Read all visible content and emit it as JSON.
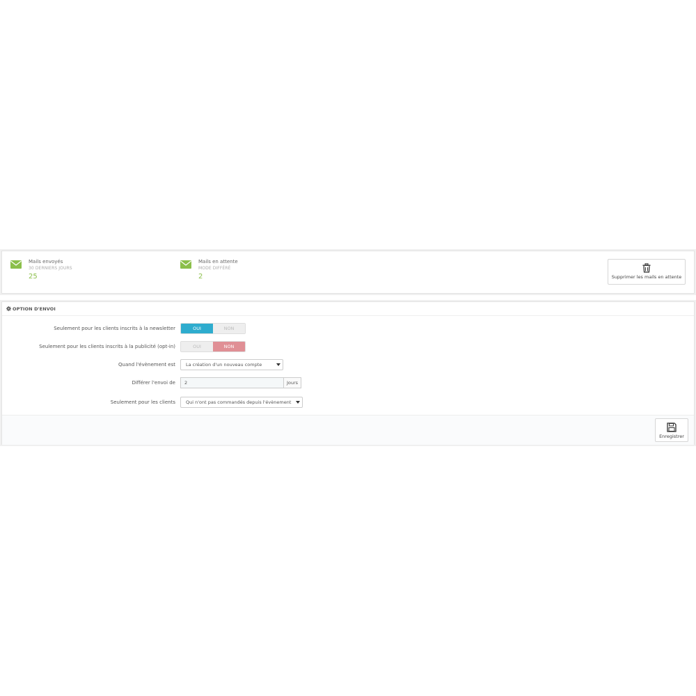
{
  "stats": [
    {
      "icon": "envelope-icon",
      "title": "Mails envoyés",
      "subtitle": "30 DERNIERS JOURS",
      "value": "25"
    },
    {
      "icon": "envelope-icon",
      "title": "Mails en attente",
      "subtitle": "MODE DIFFÉRÉ",
      "value": "2"
    }
  ],
  "delete_button": {
    "icon": "trash-icon",
    "label": "Supprimer les mails en attente"
  },
  "options": {
    "heading_icon": "cog-icon",
    "heading": "OPTION D'ENVOI",
    "rows": [
      {
        "label": "Seulement pour les clients inscrits à la newsletter",
        "type": "switch",
        "yes": "OUI",
        "no": "NON",
        "selected": "OUI"
      },
      {
        "label": "Seulement pour les clients inscrits à la publicité (opt-in)",
        "type": "switch",
        "yes": "OUI",
        "no": "NON",
        "selected": "NON"
      },
      {
        "label": "Quand l'évènement est",
        "type": "select",
        "value": "La création d'un nouveau compte"
      },
      {
        "label": "Différer l'envoi de",
        "type": "input",
        "value": "2",
        "addon": "Jours"
      },
      {
        "label": "Seulement pour les clients",
        "type": "select",
        "value": "Qui n'ont pas commandés depuis l'évènement"
      }
    ]
  },
  "save_button": {
    "icon": "save-icon",
    "label": "Enregistrer"
  },
  "colors": {
    "accent": "#2eacce",
    "stat_value": "#8bbf4a",
    "icon_green": "#8bbf4a",
    "no_selected": "#e08f95"
  }
}
